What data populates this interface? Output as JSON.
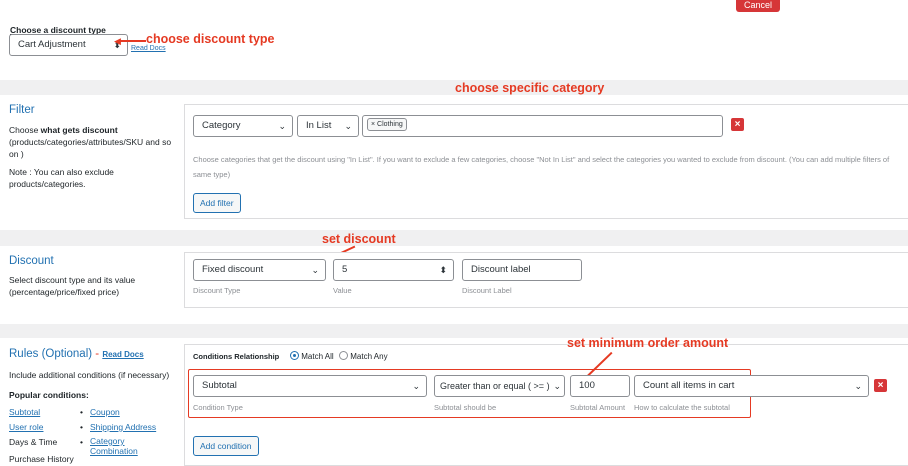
{
  "top": {
    "cancel_label": "Cancel"
  },
  "discount_type": {
    "label": "Choose a discount type",
    "selected": "Cart Adjustment",
    "read_docs": "Read Docs"
  },
  "annotations": {
    "choose_discount_type": "choose discount type",
    "choose_category": "choose specific category",
    "set_discount": "set discount",
    "set_min_order": "set minimum order amount"
  },
  "filter": {
    "title": "Filter",
    "desc_prefix": "Choose ",
    "desc_bold": "what gets discount",
    "desc_suffix": "(products/categories/attributes/SKU and so on )",
    "note": "Note : You can also exclude products/categories.",
    "type_selected": "Category",
    "method_selected": "In List",
    "tag": "Clothing",
    "tag_remove": "×",
    "help": "Choose categories that get the discount using \"In List\". If you want to exclude a few categories, choose \"Not In List\" and select the categories you wanted to exclude from discount. (You can add multiple filters of same type)",
    "add_label": "Add filter",
    "remove_label": "×"
  },
  "discount": {
    "title": "Discount",
    "desc": "Select discount type and its value (percentage/price/fixed price)",
    "type_selected": "Fixed discount",
    "type_caption": "Discount Type",
    "value": "5",
    "value_caption": "Value",
    "label_placeholder": "Discount label",
    "label_caption": "Discount Label"
  },
  "rules": {
    "title": "Rules (Optional)",
    "dash": " - ",
    "read_docs": "Read Docs",
    "desc": "Include additional conditions (if necessary)",
    "popular_label": "Popular conditions:",
    "popular": [
      [
        "Subtotal",
        "Coupon"
      ],
      [
        "User role",
        "Shipping Address"
      ],
      [
        "Days & Time",
        "Category Combination"
      ],
      [
        "Purchase History",
        ""
      ]
    ],
    "relationship_label": "Conditions Relationship",
    "match_all": "Match All",
    "match_any": "Match Any",
    "condition_type": "Subtotal",
    "condition_type_caption": "Condition Type",
    "operator": "Greater than or equal ( >= )",
    "operator_caption": "Subtotal should be",
    "amount": "100",
    "amount_caption": "Subtotal Amount",
    "calc": "Count all items in cart",
    "calc_caption": "How to calculate the subtotal",
    "add_label": "Add condition",
    "remove_label": "×"
  },
  "colors": {
    "accent": "#2271b1",
    "annotation": "#e53a23",
    "danger": "#d63638"
  }
}
